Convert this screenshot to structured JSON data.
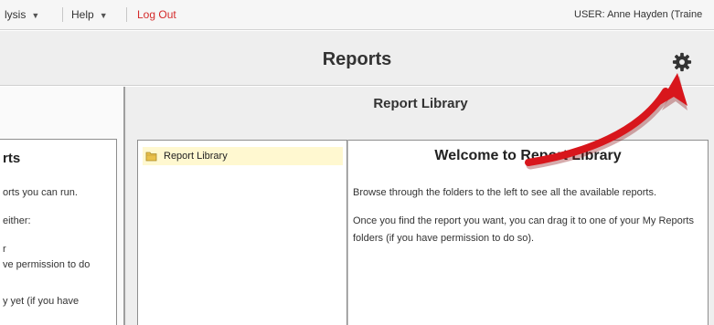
{
  "menubar": {
    "analysis_label": "lysis",
    "help_label": "Help",
    "logout_label": "Log Out",
    "user_text": "USER: Anne Hayden (Traine"
  },
  "header": {
    "title": "Reports"
  },
  "left_panel": {
    "title": "rts",
    "lines": [
      "orts you can run.",
      "either:",
      "r",
      "ve permission to do",
      "y yet (if you have"
    ]
  },
  "report_library": {
    "title": "Report Library",
    "tree": {
      "items": [
        {
          "label": "Report Library"
        }
      ]
    },
    "welcome": {
      "title": "Welcome to Report Library",
      "paragraph1": "Browse through the folders to the left to see all the available reports.",
      "paragraph2": "Once you find the report you want, you can drag it to one of your My Reports folders (if you have permission to do so)."
    }
  },
  "icons": {
    "settings": "gear-icon",
    "folder": "folder-icon",
    "dropdown": "caret-down-icon",
    "annotation": "red-arrow-annotation"
  },
  "colors": {
    "logout": "#d42a2a",
    "annotation_arrow": "#d8161c",
    "selected_row": "#fff8d0"
  }
}
